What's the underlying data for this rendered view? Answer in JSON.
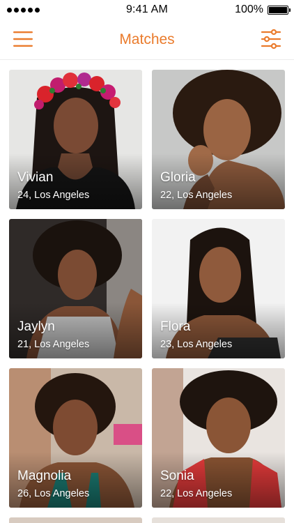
{
  "status_bar": {
    "time": "9:41 AM",
    "battery": "100%",
    "signal_icon": "signal-dots-icon",
    "battery_icon": "battery-icon"
  },
  "header": {
    "title": "Matches",
    "menu_icon": "hamburger-menu-icon",
    "filter_icon": "filter-sliders-icon",
    "accent_color": "#ea7b2c"
  },
  "matches": [
    {
      "name": "Vivian",
      "age_city": "24, Los Angeles"
    },
    {
      "name": "Gloria",
      "age_city": "22, Los Angeles"
    },
    {
      "name": "Jaylyn",
      "age_city": "21, Los Angeles"
    },
    {
      "name": "Flora",
      "age_city": "23, Los Angeles"
    },
    {
      "name": "Magnolia",
      "age_city": "26, Los Angeles"
    },
    {
      "name": "Sonia",
      "age_city": "22, Los Angeles"
    }
  ]
}
